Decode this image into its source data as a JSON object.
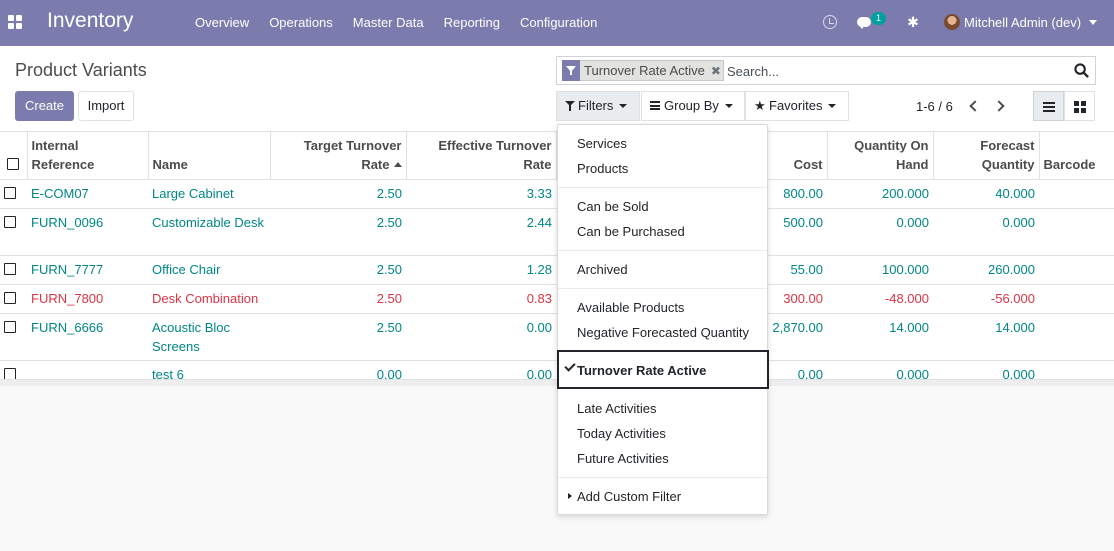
{
  "navbar": {
    "app_name": "Inventory",
    "menu": [
      "Overview",
      "Operations",
      "Master Data",
      "Reporting",
      "Configuration"
    ],
    "chat_badge": "1",
    "user": "Mitchell Admin (dev)",
    "bg_color": "#7c7bad"
  },
  "control": {
    "title": "Product Variants",
    "create_label": "Create",
    "import_label": "Import",
    "search": {
      "facet_value": "Turnover Rate Active",
      "facet_remove": "✖",
      "placeholder": "Search..."
    },
    "filters_label": "Filters",
    "groupby_label": "Group By",
    "favorites_label": "Favorites",
    "pager": "1-6 / 6"
  },
  "table": {
    "headers": [
      [
        "Internal",
        "Reference"
      ],
      [
        "",
        "Name"
      ],
      [
        "Target Turnover",
        "Rate"
      ],
      [
        "Effective Turnover",
        "Rate"
      ],
      [
        "",
        "Cost"
      ],
      [
        "Quantity On",
        "Hand"
      ],
      [
        "Forecast",
        "Quantity"
      ],
      [
        "",
        "Barcode"
      ]
    ],
    "rows": [
      {
        "ref": "E-COM07",
        "name": "Large Cabinet",
        "target": "2.50",
        "effective": "3.33",
        "cost": "800.00",
        "qty": "200.000",
        "forecast": "40.000",
        "barcode": "",
        "name2": ""
      },
      {
        "ref": "FURN_0096",
        "name": "Customizable Desk",
        "target": "2.50",
        "effective": "2.44",
        "cost": "500.00",
        "qty": "0.000",
        "forecast": "0.000",
        "barcode": "",
        "name2": ""
      },
      {
        "ref": "FURN_7777",
        "name": "Office Chair",
        "target": "2.50",
        "effective": "1.28",
        "cost": "55.00",
        "qty": "100.000",
        "forecast": "260.000",
        "barcode": "",
        "name2": ""
      },
      {
        "ref": "FURN_7800",
        "name": "Desk Combination",
        "target": "2.50",
        "effective": "0.83",
        "cost": "300.00",
        "qty": "-48.000",
        "forecast": "-56.000",
        "barcode": "",
        "name2": ""
      },
      {
        "ref": "FURN_6666",
        "name": "Acoustic Bloc",
        "name2": "Screens",
        "target": "2.50",
        "effective": "0.00",
        "cost": "2,870.00",
        "qty": "14.000",
        "forecast": "14.000",
        "barcode": ""
      },
      {
        "ref": "",
        "name": "test 6",
        "target": "0.00",
        "effective": "0.00",
        "cost": "0.00",
        "qty": "0.000",
        "forecast": "0.000",
        "barcode": "",
        "name2": ""
      }
    ]
  },
  "filters_menu": {
    "groups": [
      [
        "Services",
        "Products"
      ],
      [
        "Can be Sold",
        "Can be Purchased"
      ],
      [
        "Archived"
      ],
      [
        "Available Products",
        "Negative Forecasted Quantity"
      ],
      [
        "Turnover Rate Active"
      ],
      [
        "Late Activities",
        "Today Activities",
        "Future Activities"
      ],
      [
        "Add Custom Filter"
      ]
    ],
    "selected": "Turnover Rate Active"
  }
}
